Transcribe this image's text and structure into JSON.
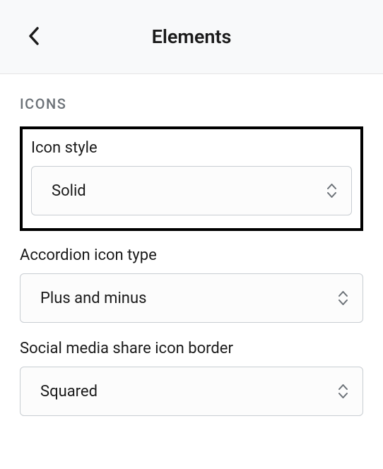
{
  "header": {
    "title": "Elements"
  },
  "section": {
    "title": "ICONS"
  },
  "form": {
    "icon_style": {
      "label": "Icon style",
      "value": "Solid"
    },
    "accordion_icon_type": {
      "label": "Accordion icon type",
      "value": "Plus and minus"
    },
    "social_border": {
      "label": "Social media share icon border",
      "value": "Squared"
    }
  }
}
